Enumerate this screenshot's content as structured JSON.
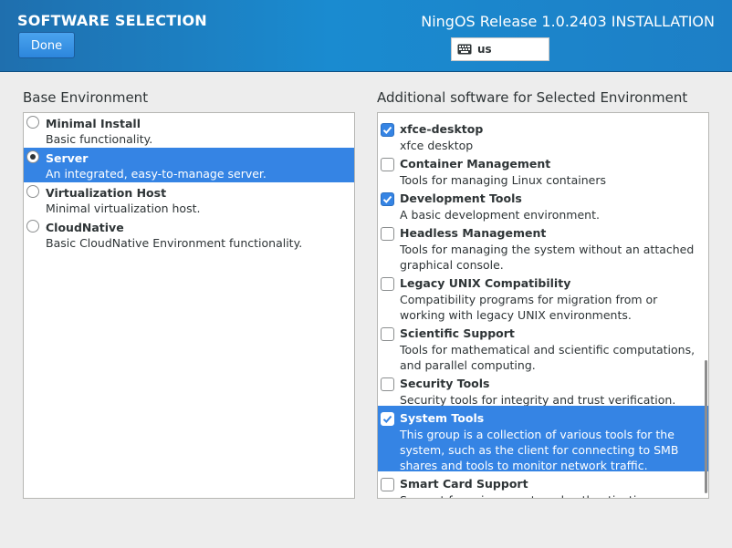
{
  "header": {
    "title": "SOFTWARE SELECTION",
    "done_label": "Done",
    "product": "NingOS Release 1.0.2403 INSTALLATION",
    "keyboard_layout": "us",
    "keyboard_icon": "keyboard-icon"
  },
  "base_environment": {
    "label": "Base Environment",
    "items": [
      {
        "name": "Minimal Install",
        "desc": "Basic functionality.",
        "selected": false
      },
      {
        "name": "Server",
        "desc": "An integrated, easy-to-manage server.",
        "selected": true
      },
      {
        "name": "Virtualization Host",
        "desc": "Minimal virtualization host.",
        "selected": false
      },
      {
        "name": "CloudNative",
        "desc": "Basic CloudNative Environment functionality.",
        "selected": false
      }
    ]
  },
  "additional_software": {
    "label": "Additional software for Selected Environment",
    "items": [
      {
        "name": "xfce-desktop",
        "desc": "xfce desktop",
        "checked": true,
        "selected": false
      },
      {
        "name": "Container Management",
        "desc": "Tools for managing Linux containers",
        "checked": false,
        "selected": false
      },
      {
        "name": "Development Tools",
        "desc": "A basic development environment.",
        "checked": true,
        "selected": false
      },
      {
        "name": "Headless Management",
        "desc": "Tools for managing the system without an attached graphical console.",
        "checked": false,
        "selected": false
      },
      {
        "name": "Legacy UNIX Compatibility",
        "desc": "Compatibility programs for migration from or working with legacy UNIX environments.",
        "checked": false,
        "selected": false
      },
      {
        "name": "Scientific Support",
        "desc": "Tools for mathematical and scientific computations, and parallel computing.",
        "checked": false,
        "selected": false
      },
      {
        "name": "Security Tools",
        "desc": "Security tools for integrity and trust verification.",
        "checked": false,
        "selected": false
      },
      {
        "name": "System Tools",
        "desc": "This group is a collection of various tools for the system, such as the client for connecting to SMB shares and tools to monitor network traffic.",
        "checked": true,
        "selected": true
      },
      {
        "name": "Smart Card Support",
        "desc": "Support for using smart card authentication.",
        "checked": false,
        "selected": false
      }
    ]
  },
  "colors": {
    "header_blue": "#1a8bd0",
    "selection_blue": "#3584e4"
  }
}
